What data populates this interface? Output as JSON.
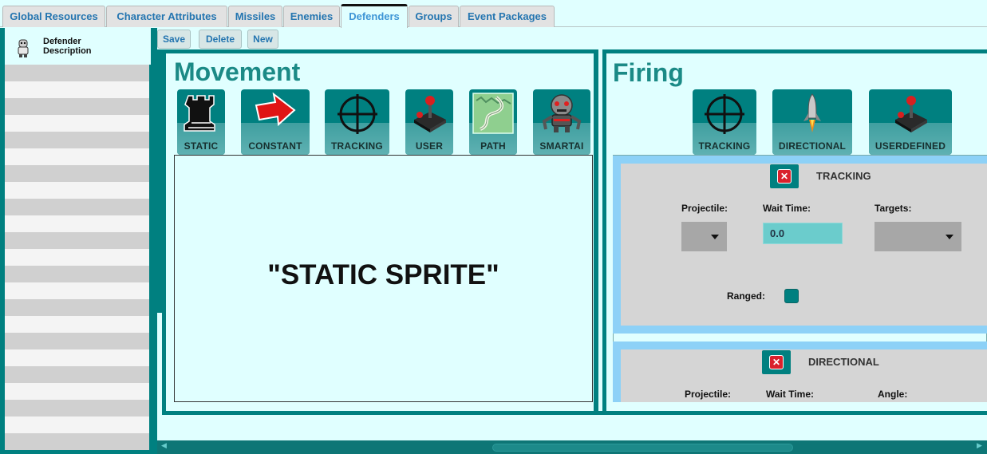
{
  "tabs": [
    {
      "label": "Global Resources"
    },
    {
      "label": "Character Attributes"
    },
    {
      "label": "Missiles"
    },
    {
      "label": "Enemies"
    },
    {
      "label": "Defenders"
    },
    {
      "label": "Groups"
    },
    {
      "label": "Event Packages"
    }
  ],
  "sidebar": {
    "header_line1": "Defender",
    "header_line2": "Description"
  },
  "toolbar": {
    "save_label": "Save",
    "delete_label": "Delete",
    "new_label": "New"
  },
  "movement": {
    "title": "Movement",
    "buttons": [
      {
        "label": "STATIC",
        "icon": "rook-icon"
      },
      {
        "label": "CONSTANT",
        "icon": "arrow-icon"
      },
      {
        "label": "TRACKING",
        "icon": "crosshair-icon"
      },
      {
        "label": "USER",
        "icon": "joystick-icon"
      },
      {
        "label": "PATH",
        "icon": "path-map-icon"
      },
      {
        "label": "SMARTAI",
        "icon": "robot-icon"
      }
    ],
    "preview_text": "\"STATIC SPRITE\""
  },
  "firing": {
    "title": "Firing",
    "buttons": [
      {
        "label": "TRACKING",
        "icon": "crosshair-icon"
      },
      {
        "label": "DIRECTIONAL",
        "icon": "rocket-icon"
      },
      {
        "label": "USERDEFINED",
        "icon": "joystick-icon"
      }
    ],
    "tracking_card": {
      "title": "TRACKING",
      "projectile_label": "Projectile:",
      "wait_label": "Wait Time:",
      "wait_value": "0.0",
      "targets_label": "Targets:",
      "ranged_label": "Ranged:"
    },
    "directional_card": {
      "title": "DIRECTIONAL",
      "projectile_label": "Projectile:",
      "wait_label": "Wait Time:",
      "angle_label": "Angle:"
    }
  },
  "colors": {
    "teal": "#008080",
    "background": "#e0ffff",
    "tab_text": "#2475b0",
    "card_bg": "#d5d5d5",
    "card_frame": "#8dd1f7"
  }
}
